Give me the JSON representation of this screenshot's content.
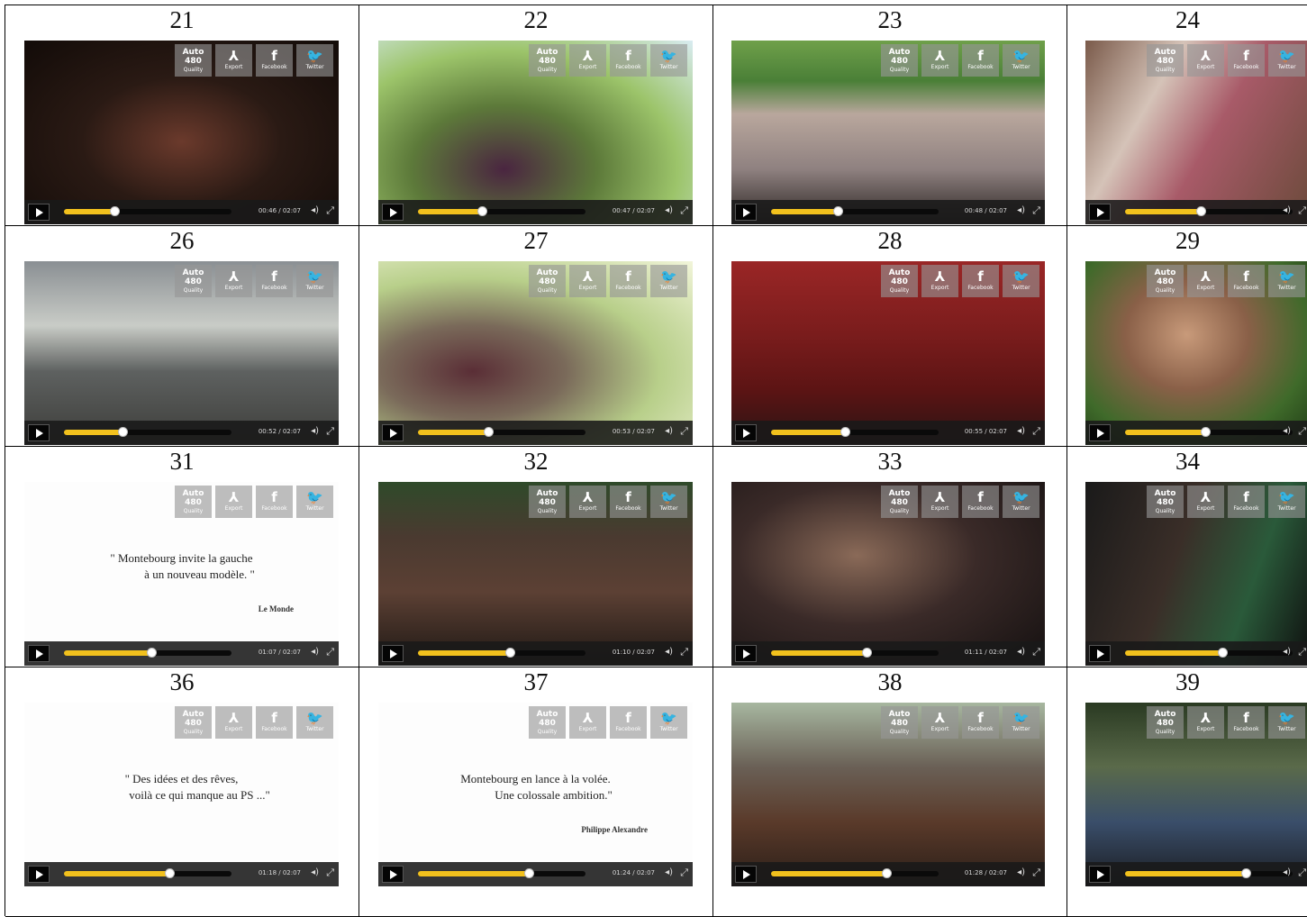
{
  "accent": "#f2c11d",
  "share_buttons": [
    {
      "icon": "quality-icon",
      "glyph": "Auto\n480",
      "label": "Quality"
    },
    {
      "icon": "export-icon",
      "glyph": "⅄",
      "label": "Export"
    },
    {
      "icon": "facebook-icon",
      "glyph": "f",
      "label": "Facebook"
    },
    {
      "icon": "twitter-icon",
      "glyph": "🐦",
      "label": "Twitter"
    }
  ],
  "controls": {
    "volume_icon": "volume-icon",
    "fullscreen_icon": "fullscreen-icon"
  },
  "cells": [
    {
      "number": "21",
      "progress": 0.3,
      "time": "00:46 / 02:07",
      "scene": "press-conference"
    },
    {
      "number": "22",
      "progress": 0.38,
      "time": "00:47 / 02:07",
      "scene": "outdoor-trees"
    },
    {
      "number": "23",
      "progress": 0.4,
      "time": "00:48 / 02:07",
      "scene": "crowd-stage"
    },
    {
      "number": "24",
      "progress": 0.45,
      "time": "",
      "scene": "crowd-people"
    },
    {
      "number": "26",
      "progress": 0.35,
      "time": "00:52 / 02:07",
      "scene": "cow-barn"
    },
    {
      "number": "27",
      "progress": 0.42,
      "time": "00:53 / 02:07",
      "scene": "outdoor-sun"
    },
    {
      "number": "28",
      "progress": 0.44,
      "time": "00:55 / 02:07",
      "scene": "parliament"
    },
    {
      "number": "29",
      "progress": 0.48,
      "time": "",
      "scene": "portrait"
    },
    {
      "number": "31",
      "progress": 0.52,
      "time": "01:07 / 02:07",
      "scene": "quote",
      "quote": [
        "\" Montebourg invite la gauche",
        "à un nouveau modèle. \""
      ],
      "source": "Le Monde"
    },
    {
      "number": "32",
      "progress": 0.55,
      "time": "01:10 / 02:07",
      "scene": "hall-crowd"
    },
    {
      "number": "33",
      "progress": 0.57,
      "time": "01:11 / 02:07",
      "scene": "interview"
    },
    {
      "number": "34",
      "progress": 0.58,
      "time": "",
      "scene": "night-crowd"
    },
    {
      "number": "36",
      "progress": 0.63,
      "time": "01:18 / 02:07",
      "scene": "quote",
      "quote": [
        "\" Des idées et des rêves,",
        "voilà ce qui manque au PS ...\""
      ],
      "source": ""
    },
    {
      "number": "37",
      "progress": 0.66,
      "time": "01:24 / 02:07",
      "scene": "quote",
      "quote": [
        "Montebourg en lance à la volée.",
        "Une colossale ambition.\""
      ],
      "source": "Philippe Alexandre"
    },
    {
      "number": "38",
      "progress": 0.69,
      "time": "01:28 / 02:07",
      "scene": "street-crowd"
    },
    {
      "number": "39",
      "progress": 0.72,
      "time": "",
      "scene": "forest-group"
    }
  ]
}
